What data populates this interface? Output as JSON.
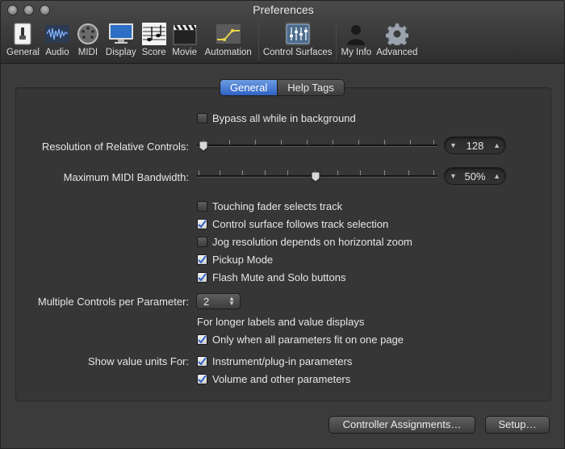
{
  "window": {
    "title": "Preferences"
  },
  "toolbar": {
    "items": [
      {
        "label": "General",
        "icon": "general-switch-icon"
      },
      {
        "label": "Audio",
        "icon": "audio-waveform-icon"
      },
      {
        "label": "MIDI",
        "icon": "midi-connector-icon"
      },
      {
        "label": "Display",
        "icon": "display-monitor-icon"
      },
      {
        "label": "Score",
        "icon": "score-notes-icon"
      },
      {
        "label": "Movie",
        "icon": "movie-clapper-icon"
      },
      {
        "label": "Automation",
        "icon": "automation-curve-icon"
      },
      {
        "label": "Control Surfaces",
        "icon": "control-surface-icon"
      },
      {
        "label": "My Info",
        "icon": "person-silhouette-icon"
      },
      {
        "label": "Advanced",
        "icon": "gear-icon"
      }
    ],
    "active": "Control Surfaces"
  },
  "tabs": {
    "general": "General",
    "help_tags": "Help Tags",
    "selected": "General"
  },
  "settings": {
    "bypass": {
      "label": "Bypass all while in background",
      "checked": false
    },
    "resolution": {
      "label": "Resolution of Relative Controls:",
      "value": "128",
      "slider_fraction": 0.0
    },
    "midi_bandwidth": {
      "label": "Maximum MIDI Bandwidth:",
      "value": "50%",
      "slider_fraction": 0.5
    },
    "touching_fader": {
      "label": "Touching fader selects track",
      "checked": false
    },
    "follows_track": {
      "label": "Control surface follows track selection",
      "checked": true
    },
    "jog_resolution": {
      "label": "Jog resolution depends on horizontal zoom",
      "checked": false
    },
    "pickup_mode": {
      "label": "Pickup Mode",
      "checked": true
    },
    "flash_mute": {
      "label": "Flash Mute and Solo buttons",
      "checked": true
    },
    "multiple_controls": {
      "label": "Multiple Controls per Parameter:",
      "value": "2"
    },
    "longer_labels": {
      "label": "For longer labels and value displays"
    },
    "only_when_fit": {
      "label": "Only when all parameters fit on one page",
      "checked": true
    },
    "value_units": {
      "label": "Show value units For:"
    },
    "instrument_params": {
      "label": "Instrument/plug-in parameters",
      "checked": true
    },
    "volume_params": {
      "label": "Volume and other parameters",
      "checked": true
    }
  },
  "buttons": {
    "controller_assignments": "Controller Assignments…",
    "setup": "Setup…"
  },
  "colors": {
    "accent": "#2f62c4",
    "background": "#3b3b3b"
  }
}
